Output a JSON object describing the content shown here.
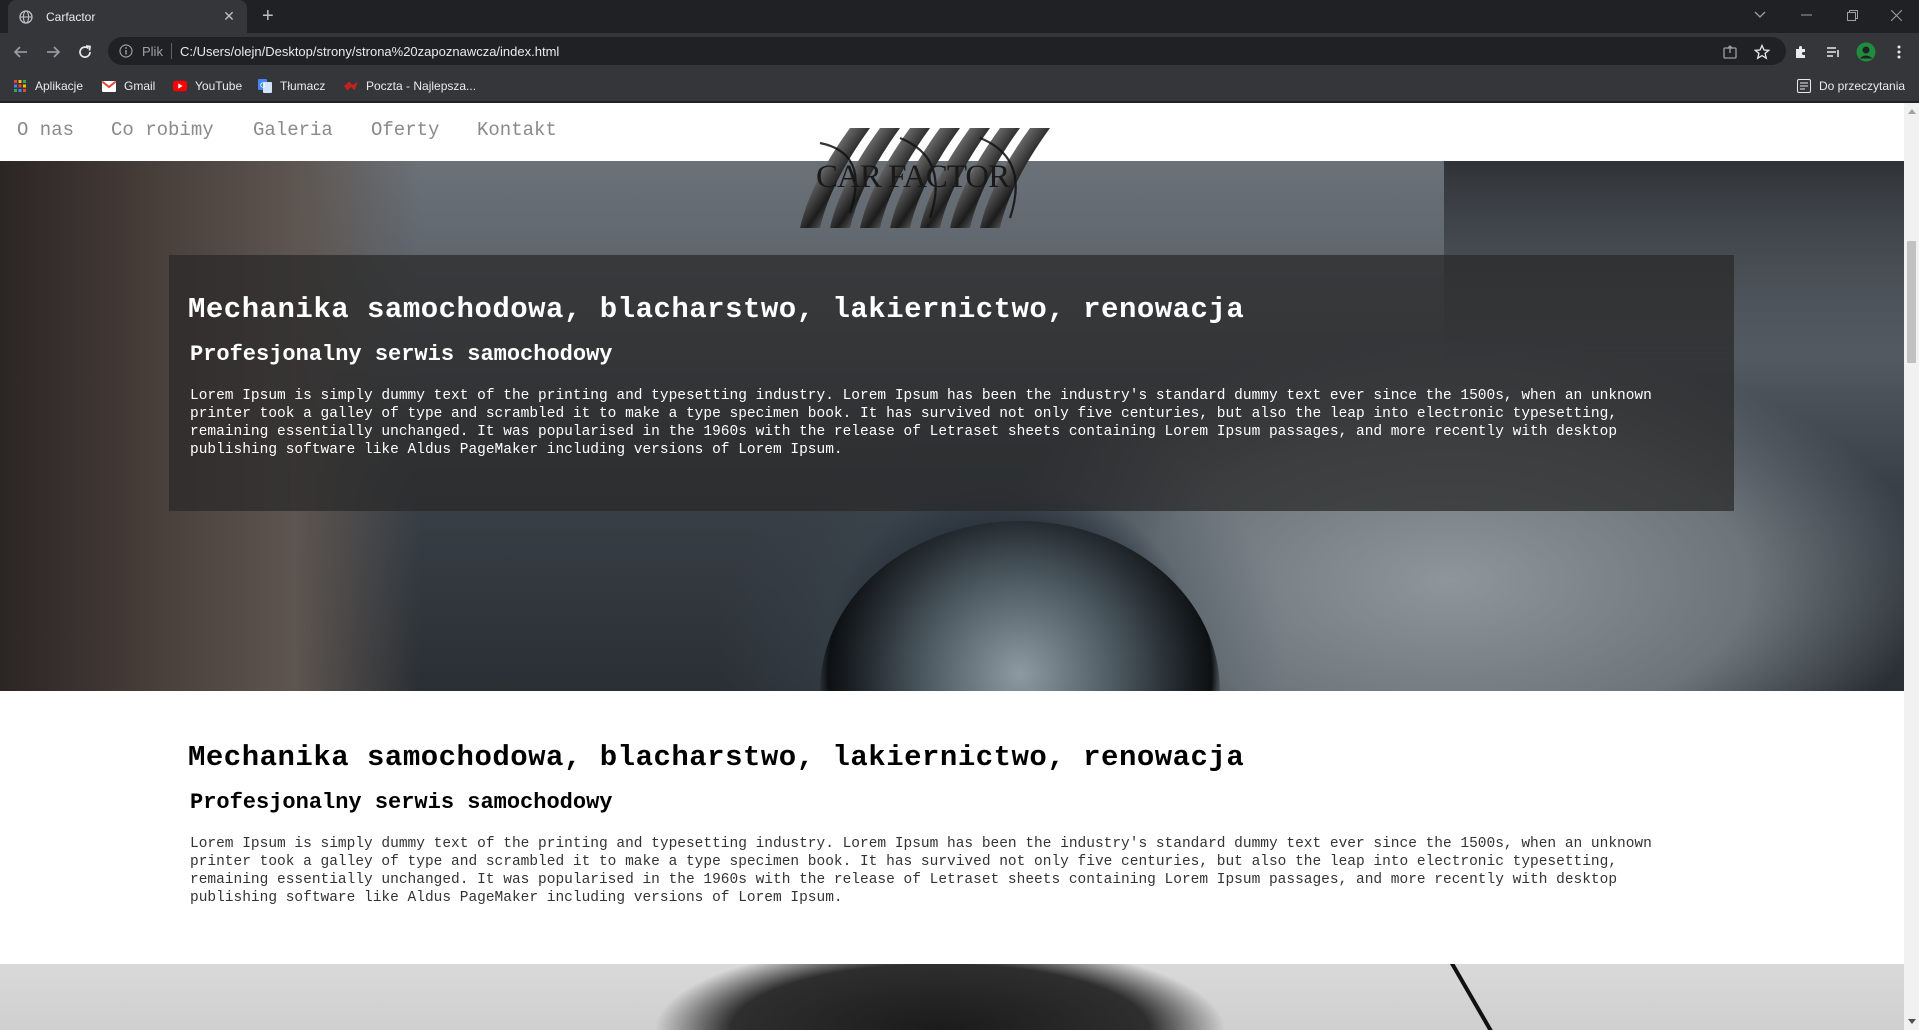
{
  "browser": {
    "tab_title": "Carfactor",
    "url_scheme": "Plik",
    "url": "C:/Users/olejn/Desktop/strony/strona%20zapoznawcza/index.html",
    "bookmarks": [
      {
        "label": "Aplikacje",
        "icon": "apps-grid-icon"
      },
      {
        "label": "Gmail",
        "icon": "gmail-icon"
      },
      {
        "label": "YouTube",
        "icon": "youtube-icon"
      },
      {
        "label": "Tłumacz",
        "icon": "translate-icon"
      },
      {
        "label": "Poczta - Najlepsza...",
        "icon": "mail-icon"
      }
    ],
    "reading_list": "Do przeczytania"
  },
  "nav": {
    "items": [
      "O nas",
      "Co robimy",
      "Galeria",
      "Oferty",
      "Kontakt"
    ]
  },
  "logo": {
    "text": "CAR FACTOR"
  },
  "hero": {
    "title": "Mechanika samochodowa, blacharstwo, lakiernictwo, renowacja",
    "subtitle": "Profesjonalny serwis samochodowy",
    "body": "Lorem Ipsum is simply dummy text of the printing and typesetting industry. Lorem Ipsum has been the industry's standard dummy text ever since the 1500s, when an unknown printer took a galley of type and scrambled it to make a type specimen book. It has survived not only five centuries, but also the leap into electronic typesetting, remaining essentially unchanged. It was popularised in the 1960s with the release of Letraset sheets containing Lorem Ipsum passages, and more recently with desktop publishing software like Aldus PageMaker including versions of Lorem Ipsum."
  },
  "section": {
    "title": "Mechanika samochodowa, blacharstwo, lakiernictwo, renowacja",
    "subtitle": "Profesjonalny serwis samochodowy",
    "body": "Lorem Ipsum is simply dummy text of the printing and typesetting industry. Lorem Ipsum has been the industry's standard dummy text ever since the 1500s, when an unknown printer took a galley of type and scrambled it to make a type specimen book. It has survived not only five centuries, but also the leap into electronic typesetting, remaining essentially unchanged. It was popularised in the 1960s with the release of Letraset sheets containing Lorem Ipsum passages, and more recently with desktop publishing software like Aldus PageMaker including versions of Lorem Ipsum."
  }
}
